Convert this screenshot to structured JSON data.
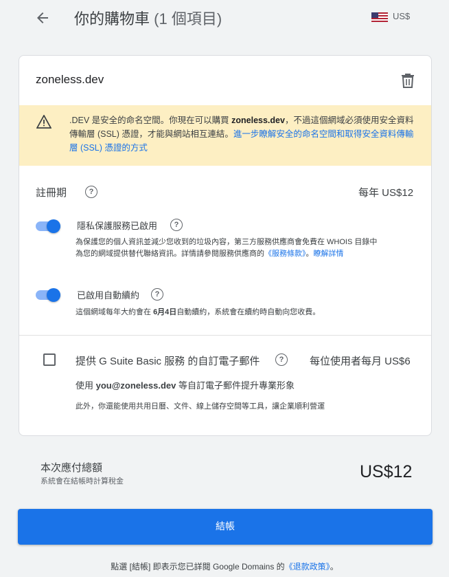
{
  "header": {
    "title": "你的購物車",
    "item_count": "(1 個項目)",
    "currency": "US$"
  },
  "cart": {
    "domain": "zoneless.dev",
    "warning": {
      "prefix": ".DEV 是安全的命名空間。你現在可以購買 ",
      "domain": "zoneless.dev",
      "middle": "，不過這個網域必須使用安全資料傳輸層 (SSL) 憑證，才能與網站相互連結。",
      "link": "進一步瞭解安全的命名空間和取得安全資料傳輸層 (SSL) 憑證的方式"
    },
    "registration": {
      "label": "註冊期",
      "price": "每年 US$12"
    },
    "privacy": {
      "label": "隱私保護服務已啟用",
      "desc": "為保護您的個人資訊並減少您收到的垃圾內容，第三方服務供應商會免費在 WHOIS 目錄中為您的網域提供替代聯絡資訊。詳情請參閱服務供應商的",
      "terms_link": "《服務條款》",
      "learn_more": "瞭解詳情",
      "enabled": true
    },
    "autorenew": {
      "label": "已啟用自動續約",
      "desc_prefix": "這個網域每年大約會在 ",
      "date": "6月4日",
      "desc_suffix": "自動續約，系統會在續約時自動向您收費。",
      "enabled": true
    },
    "gsuite": {
      "label": "提供 G Suite Basic 服務  的自訂電子郵件",
      "price": "每位使用者每月 US$6",
      "line1_prefix": "使用 ",
      "email": "you@zoneless.dev",
      "line1_suffix": " 等自訂電子郵件提升專業形象",
      "line2": "此外，你還能使用共用日曆、文件、線上儲存空間等工具，讓企業順利營運",
      "checked": false
    }
  },
  "summary": {
    "total_label": "本次應付總額",
    "tax_note": "系統會在結帳時計算稅金",
    "total": "US$12"
  },
  "checkout_label": "結帳",
  "footer": {
    "prefix": "點選 [結帳] 即表示您已詳閱 Google Domains 的",
    "link": "《退款政策》",
    "suffix": "。"
  },
  "colors": {
    "accent": "#1a73e8",
    "warning_bg": "#fdefc3"
  },
  "icons": [
    "back-arrow-icon",
    "us-flag-icon",
    "trash-icon",
    "warning-icon",
    "help-icon"
  ]
}
